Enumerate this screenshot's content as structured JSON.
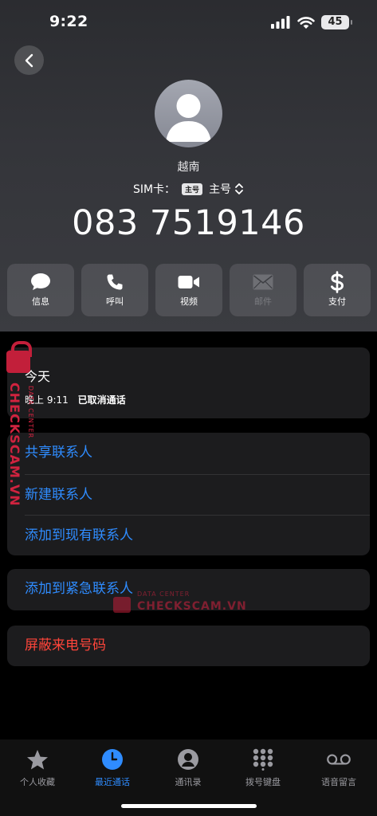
{
  "status_bar": {
    "time": "9:22",
    "battery": "45"
  },
  "contact": {
    "label": "越南",
    "sim_prefix": "SIM卡：",
    "sim_badge": "主号",
    "sim_name": "主号",
    "phone_number": "083 7519146"
  },
  "actions": [
    {
      "label": "信息",
      "icon": "message-bubble-icon",
      "enabled": true
    },
    {
      "label": "呼叫",
      "icon": "phone-icon",
      "enabled": true
    },
    {
      "label": "视频",
      "icon": "video-camera-icon",
      "enabled": true
    },
    {
      "label": "邮件",
      "icon": "envelope-icon",
      "enabled": false
    },
    {
      "label": "支付",
      "icon": "dollar-icon",
      "enabled": true
    }
  ],
  "recent_calls": {
    "title": "今天",
    "time": "晚上 9:11",
    "status": "已取消通话"
  },
  "contact_links": {
    "share": "共享联系人",
    "new": "新建联系人",
    "add_existing": "添加到现有联系人",
    "emergency": "添加到紧急联系人",
    "block": "屏蔽来电号码"
  },
  "watermark": {
    "vertical_text": "CHECKSCAM.VN",
    "vertical_sub": "DATA CENTER",
    "horizontal_sub": "DATA CENTER",
    "horizontal_text": "CHECKSCAM.VN"
  },
  "tabbar": [
    {
      "label": "个人收藏",
      "icon": "star-icon",
      "active": false
    },
    {
      "label": "最近通话",
      "icon": "clock-icon",
      "active": true
    },
    {
      "label": "通讯录",
      "icon": "person-circle-icon",
      "active": false
    },
    {
      "label": "拨号键盘",
      "icon": "keypad-icon",
      "active": false
    },
    {
      "label": "语音留言",
      "icon": "voicemail-icon",
      "active": false
    }
  ],
  "colors": {
    "accent": "#2f8cff",
    "destructive": "#ff453a",
    "card": "#1c1c1e"
  }
}
